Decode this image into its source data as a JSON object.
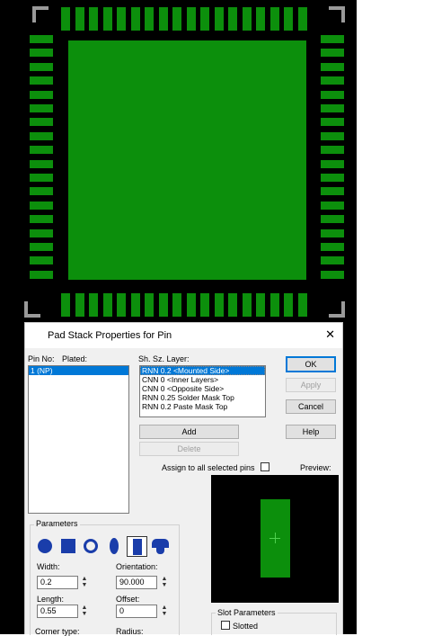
{
  "dialog": {
    "title": "Pad Stack Properties for Pin",
    "close_glyph": "✕",
    "pin_no_label": "Pin No:",
    "plated_label": "Plated:",
    "pins": [
      "1 (NP)"
    ],
    "layer_header": "Sh. Sz. Layer:",
    "layers": [
      "RNN 0.2 <Mounted Side>",
      "CNN 0 <Inner Layers>",
      "CNN 0 <Opposite Side>",
      "RNN 0.25 Solder Mask Top",
      "RNN 0.2 Paste Mask Top"
    ],
    "buttons": {
      "ok": "OK",
      "apply": "Apply",
      "cancel": "Cancel",
      "help": "Help",
      "add": "Add",
      "delete": "Delete"
    },
    "assign_all_label": "Assign to all selected pins",
    "assign_all_checked": false,
    "preview_label": "Preview:",
    "parameters": {
      "title": "Parameters",
      "shapes": [
        "circle-shape-icon",
        "square-shape-icon",
        "annulus-shape-icon",
        "oval-shape-icon",
        "rectangle-shape-icon",
        "bullet-shape-icon"
      ],
      "selected_shape_index": 4,
      "width_label": "Width:",
      "width_value": "0.2",
      "orientation_label": "Orientation:",
      "orientation_value": "90.000",
      "length_label": "Length:",
      "length_value": "0.55",
      "offset_label": "Offset:",
      "offset_value": "0",
      "corner_type_label": "Corner type:",
      "radius_label": "Radius:"
    },
    "slot": {
      "title": "Slot Parameters",
      "slotted_label": "Slotted",
      "slotted_checked": false
    }
  },
  "colors": {
    "pad_green": "#0c8f0c",
    "canvas_black": "#000000",
    "selection_blue": "#0078d7",
    "shape_blue": "#1a3daa"
  }
}
